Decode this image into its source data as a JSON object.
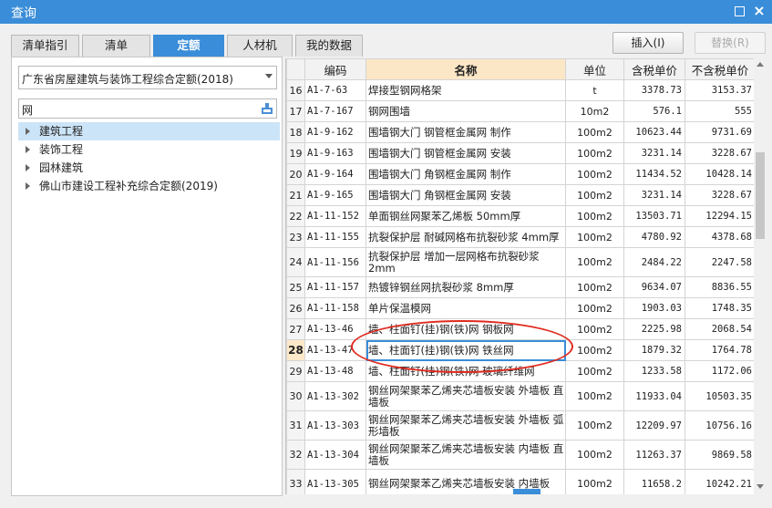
{
  "window": {
    "title": "查询"
  },
  "tabs": [
    {
      "label": "清单指引",
      "active": false
    },
    {
      "label": "清单",
      "active": false
    },
    {
      "label": "定额",
      "active": true
    },
    {
      "label": "人材机",
      "active": false
    },
    {
      "label": "我的数据",
      "active": false
    }
  ],
  "actions": {
    "insert_label": "插入(I)",
    "replace_label": "替换(R)",
    "replace_enabled": false
  },
  "left": {
    "quota_library": "广东省房屋建筑与装饰工程综合定额(2018)",
    "search_value": "网",
    "tree": [
      {
        "label": "建筑工程",
        "selected": true
      },
      {
        "label": "装饰工程",
        "selected": false
      },
      {
        "label": "园林建筑",
        "selected": false
      },
      {
        "label": "佛山市建设工程补充综合定额(2019)",
        "selected": false
      }
    ]
  },
  "table": {
    "columns": [
      "",
      "编码",
      "名称",
      "单位",
      "含税单价",
      "不含税单价"
    ],
    "current_row": "28",
    "rows": [
      {
        "num": "16",
        "code": "A1-7-63",
        "name": "焊接型钢网格架",
        "unit": "t",
        "price_tax": "3378.73",
        "price_notax": "3153.37"
      },
      {
        "num": "17",
        "code": "A1-7-167",
        "name": "钢网围墙",
        "unit": "10m2",
        "price_tax": "576.1",
        "price_notax": "555"
      },
      {
        "num": "18",
        "code": "A1-9-162",
        "name": "围墙钢大门 钢管框金属网 制作",
        "unit": "100m2",
        "price_tax": "10623.44",
        "price_notax": "9731.69"
      },
      {
        "num": "19",
        "code": "A1-9-163",
        "name": "围墙钢大门 钢管框金属网 安装",
        "unit": "100m2",
        "price_tax": "3231.14",
        "price_notax": "3228.67"
      },
      {
        "num": "20",
        "code": "A1-9-164",
        "name": "围墙钢大门 角钢框金属网 制作",
        "unit": "100m2",
        "price_tax": "11434.52",
        "price_notax": "10428.14"
      },
      {
        "num": "21",
        "code": "A1-9-165",
        "name": "围墙钢大门 角钢框金属网 安装",
        "unit": "100m2",
        "price_tax": "3231.14",
        "price_notax": "3228.67"
      },
      {
        "num": "22",
        "code": "A1-11-152",
        "name": "单面钢丝网聚苯乙烯板 50mm厚",
        "unit": "100m2",
        "price_tax": "13503.71",
        "price_notax": "12294.15"
      },
      {
        "num": "23",
        "code": "A1-11-155",
        "name": "抗裂保护层 耐碱网格布抗裂砂浆 4mm厚",
        "unit": "100m2",
        "price_tax": "4780.92",
        "price_notax": "4378.68"
      },
      {
        "num": "24",
        "code": "A1-11-156",
        "name": "抗裂保护层 增加一层网格布抗裂砂浆 2mm",
        "unit": "100m2",
        "price_tax": "2484.22",
        "price_notax": "2247.58",
        "tall": true
      },
      {
        "num": "25",
        "code": "A1-11-157",
        "name": "热镀锌钢丝网抗裂砂浆 8mm厚",
        "unit": "100m2",
        "price_tax": "9634.07",
        "price_notax": "8836.55"
      },
      {
        "num": "26",
        "code": "A1-11-158",
        "name": "单片保温模网",
        "unit": "100m2",
        "price_tax": "1903.03",
        "price_notax": "1748.35"
      },
      {
        "num": "27",
        "code": "A1-13-46",
        "name": "墙、柱面钉(挂)钢(铁)网 钢板网",
        "unit": "100m2",
        "price_tax": "2225.98",
        "price_notax": "2068.54"
      },
      {
        "num": "28",
        "code": "A1-13-47",
        "name": "墙、柱面钉(挂)钢(铁)网 铁丝网",
        "unit": "100m2",
        "price_tax": "1879.32",
        "price_notax": "1764.78"
      },
      {
        "num": "29",
        "code": "A1-13-48",
        "name": "墙、柱面钉(挂)钢(铁)网 玻璃纤维网",
        "unit": "100m2",
        "price_tax": "1233.58",
        "price_notax": "1172.06"
      },
      {
        "num": "30",
        "code": "A1-13-302",
        "name": "钢丝网架聚苯乙烯夹芯墙板安装 外墙板 直墙板",
        "unit": "100m2",
        "price_tax": "11933.04",
        "price_notax": "10503.35",
        "tall": true
      },
      {
        "num": "31",
        "code": "A1-13-303",
        "name": "钢丝网架聚苯乙烯夹芯墙板安装 外墙板 弧形墙板",
        "unit": "100m2",
        "price_tax": "12209.97",
        "price_notax": "10756.16",
        "tall": true
      },
      {
        "num": "32",
        "code": "A1-13-304",
        "name": "钢丝网架聚苯乙烯夹芯墙板安装 内墙板 直墙板",
        "unit": "100m2",
        "price_tax": "11263.37",
        "price_notax": "9869.58",
        "tall": true
      },
      {
        "num": "33",
        "code": "A1-13-305",
        "name": "钢丝网架聚苯乙烯夹芯墙板安装 内墙板",
        "unit": "100m2",
        "price_tax": "11658.2",
        "price_notax": "10242.21",
        "tall": true
      }
    ]
  },
  "colors": {
    "accent": "#3a8dd8",
    "header_highlight": "#fbe7c6",
    "annotation": "#e02a1f",
    "tree_selected": "#cce4f7"
  },
  "icons": {
    "restore": "restore-icon",
    "close": "close-icon",
    "search": "search-icon",
    "tree_expand": "triangle-right-icon"
  }
}
